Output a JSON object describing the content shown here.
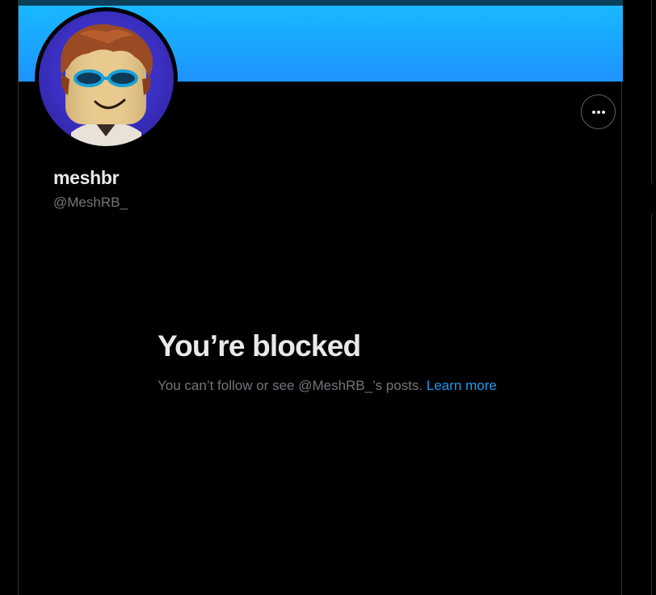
{
  "profile": {
    "display_name": "meshbr",
    "handle": "@MeshRB_"
  },
  "blocked": {
    "title": "You’re blocked",
    "message": "You can’t follow or see @MeshRB_’s posts.",
    "link_label": "Learn more"
  },
  "icons": {
    "more": "more-horizontal-icon"
  },
  "colors": {
    "background": "#000000",
    "banner": "#1da1f2",
    "link": "#1d9bf0",
    "text_primary": "#e7e9ea",
    "text_secondary": "#71767b",
    "border": "#2f3336"
  }
}
